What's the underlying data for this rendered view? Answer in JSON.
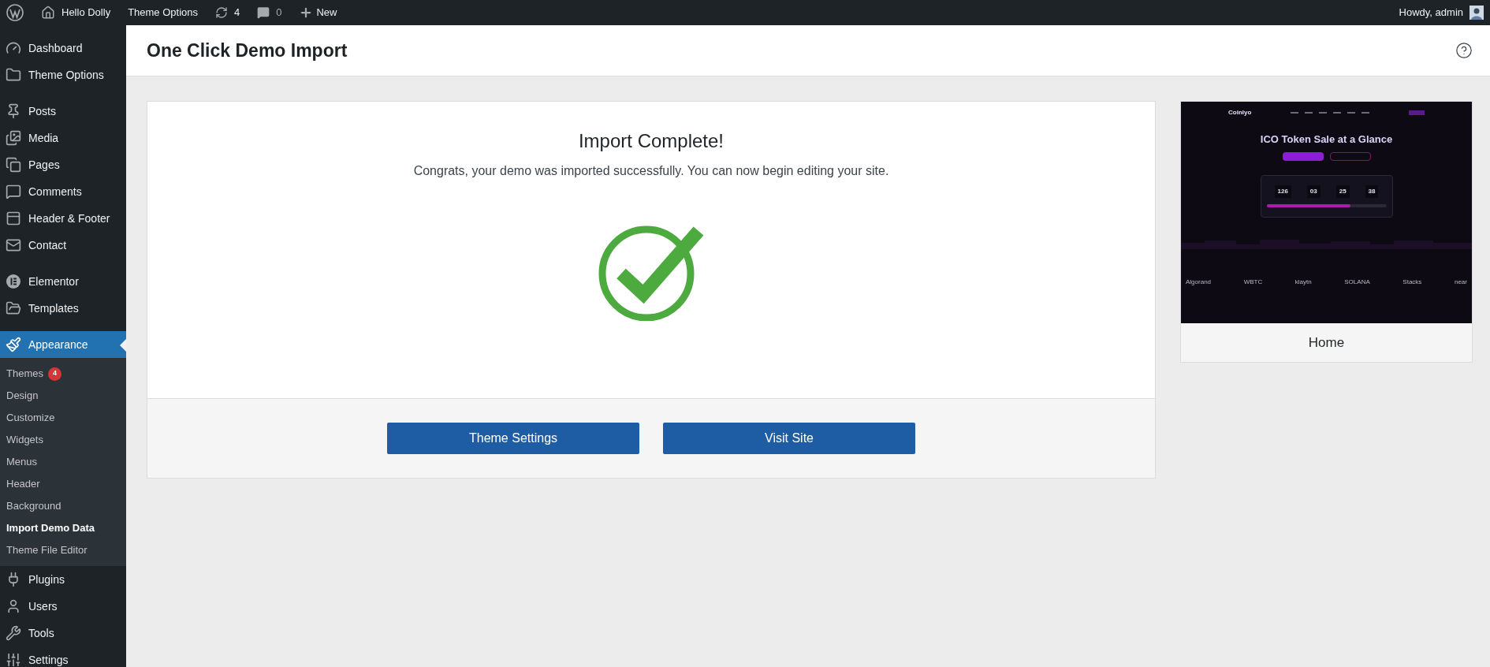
{
  "admin_bar": {
    "items": [
      {
        "kind": "logo"
      },
      {
        "kind": "home",
        "label": "Hello Dolly"
      },
      {
        "kind": "text",
        "label": "Theme Options"
      },
      {
        "kind": "updates",
        "label": "4"
      },
      {
        "kind": "comments",
        "label": "0"
      },
      {
        "kind": "new",
        "label": "New"
      }
    ],
    "greeting": "Howdy, admin"
  },
  "sidebar": {
    "groups": [
      [
        {
          "kind": "dashboard",
          "label": "Dashboard",
          "selected": false
        },
        {
          "kind": "folder",
          "label": "Theme Options",
          "selected": false
        }
      ],
      [
        {
          "kind": "pin",
          "label": "Posts",
          "selected": false
        },
        {
          "kind": "media",
          "label": "Media",
          "selected": false
        },
        {
          "kind": "pages",
          "label": "Pages",
          "selected": false
        },
        {
          "kind": "comments",
          "label": "Comments",
          "selected": false
        },
        {
          "kind": "header",
          "label": "Header & Footer",
          "selected": false
        },
        {
          "kind": "mail",
          "label": "Contact",
          "selected": false
        }
      ],
      [
        {
          "kind": "elementor",
          "label": "Elementor",
          "selected": false
        },
        {
          "kind": "folder-open",
          "label": "Templates",
          "selected": false
        }
      ],
      [
        {
          "kind": "brush",
          "label": "Appearance",
          "selected": true,
          "children": [
            {
              "label": "Themes",
              "badge": "4",
              "selected": false
            },
            {
              "label": "Design",
              "selected": false
            },
            {
              "label": "Customize",
              "selected": false
            },
            {
              "label": "Widgets",
              "selected": false
            },
            {
              "label": "Menus",
              "selected": false
            },
            {
              "label": "Header",
              "selected": false
            },
            {
              "label": "Background",
              "selected": false
            },
            {
              "label": "Import Demo Data",
              "selected": true
            },
            {
              "label": "Theme File Editor",
              "selected": false
            }
          ]
        },
        {
          "kind": "plug",
          "label": "Plugins",
          "selected": false
        },
        {
          "kind": "user",
          "label": "Users",
          "selected": false
        },
        {
          "kind": "wrench",
          "label": "Tools",
          "selected": false
        },
        {
          "kind": "settings",
          "label": "Settings",
          "selected": false
        }
      ]
    ]
  },
  "page": {
    "title": "One Click Demo Import"
  },
  "result": {
    "title": "Import Complete!",
    "message": "Congrats, your demo was imported successfully. You can now begin editing your site.",
    "buttons": [
      "Theme Settings",
      "Visit Site"
    ]
  },
  "preview": {
    "label": "Home",
    "site": {
      "brand": "Coinlyo",
      "headline": "ICO Token Sale at a Glance",
      "countdown": [
        "126",
        "03",
        "25",
        "38"
      ],
      "level": 0.7,
      "partners": [
        "Algorand",
        "WBTC",
        "klaytn",
        "SOLANA",
        "Stacks",
        "near"
      ]
    }
  }
}
